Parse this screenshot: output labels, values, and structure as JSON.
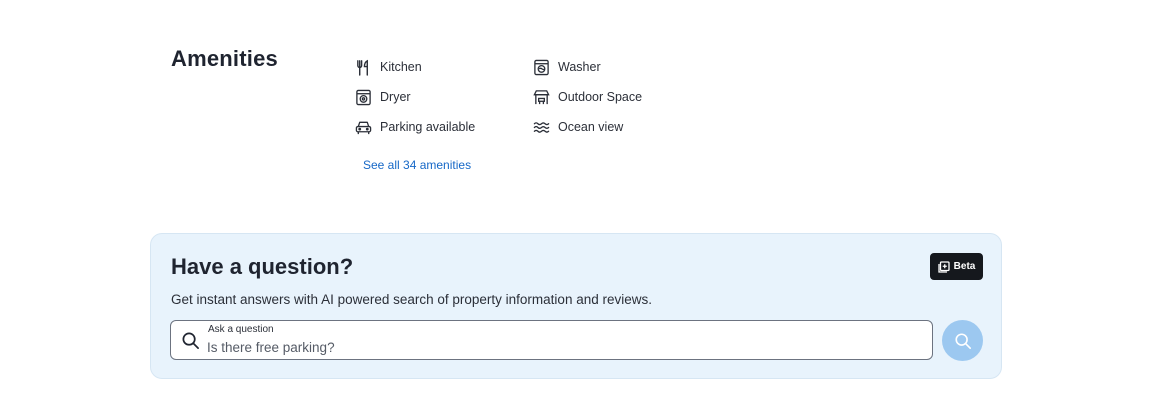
{
  "amenities": {
    "title": "Amenities",
    "items": [
      {
        "label": "Kitchen",
        "icon": "kitchen-icon"
      },
      {
        "label": "Washer",
        "icon": "washer-icon"
      },
      {
        "label": "Dryer",
        "icon": "dryer-icon"
      },
      {
        "label": "Outdoor Space",
        "icon": "outdoor-space-icon"
      },
      {
        "label": "Parking available",
        "icon": "car-icon"
      },
      {
        "label": "Ocean view",
        "icon": "waves-icon"
      }
    ],
    "see_all_link": "See all 34 amenities"
  },
  "question": {
    "title": "Have a question?",
    "subtitle": "Get instant answers with AI powered search of property information and reviews.",
    "beta_badge": "Beta",
    "input_label": "Ask a question",
    "input_placeholder": "Is there free parking?"
  },
  "colors": {
    "link": "#1668c7",
    "card_background": "#e8f3fc",
    "search_button": "#9cc8f0",
    "badge_background": "#15181d"
  }
}
